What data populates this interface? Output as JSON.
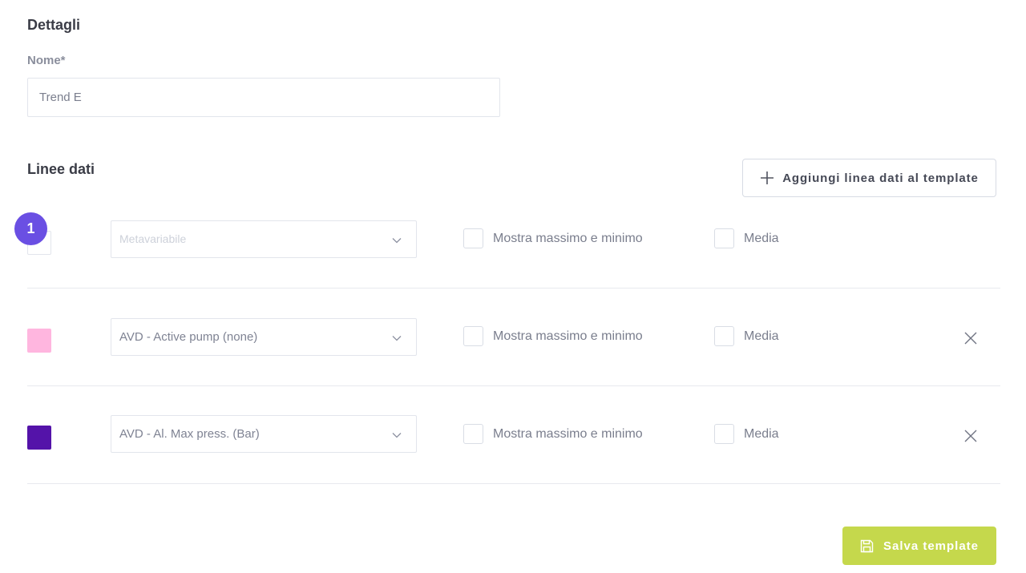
{
  "details": {
    "title": "Dettagli",
    "name_label": "Nome*",
    "name_value": "Trend E"
  },
  "lines": {
    "title": "Linee dati",
    "add_button_label": "Aggiungi linea dati al template",
    "badge": "1",
    "rows": [
      {
        "color": "#ffffff",
        "select_value": "",
        "select_placeholder": "Metavariabile",
        "minmax_label": "Mostra massimo e minimo",
        "media_label": "Media",
        "removable": false
      },
      {
        "color": "#ffb6df",
        "select_value": "AVD - Active pump (none)",
        "select_placeholder": "",
        "minmax_label": "Mostra massimo e minimo",
        "media_label": "Media",
        "removable": true
      },
      {
        "color": "#5413a9",
        "select_value": "AVD - Al. Max press. (Bar)",
        "select_placeholder": "",
        "minmax_label": "Mostra massimo e minimo",
        "media_label": "Media",
        "removable": true
      }
    ]
  },
  "footer": {
    "save_label": "Salva template"
  },
  "icons": {
    "add": "plus-icon",
    "select": "chevron-down-icon",
    "remove": "close-icon",
    "save": "floppy-disk-icon"
  },
  "colors": {
    "accent_badge": "#6a4fe3",
    "save_button": "#c5d84c"
  }
}
